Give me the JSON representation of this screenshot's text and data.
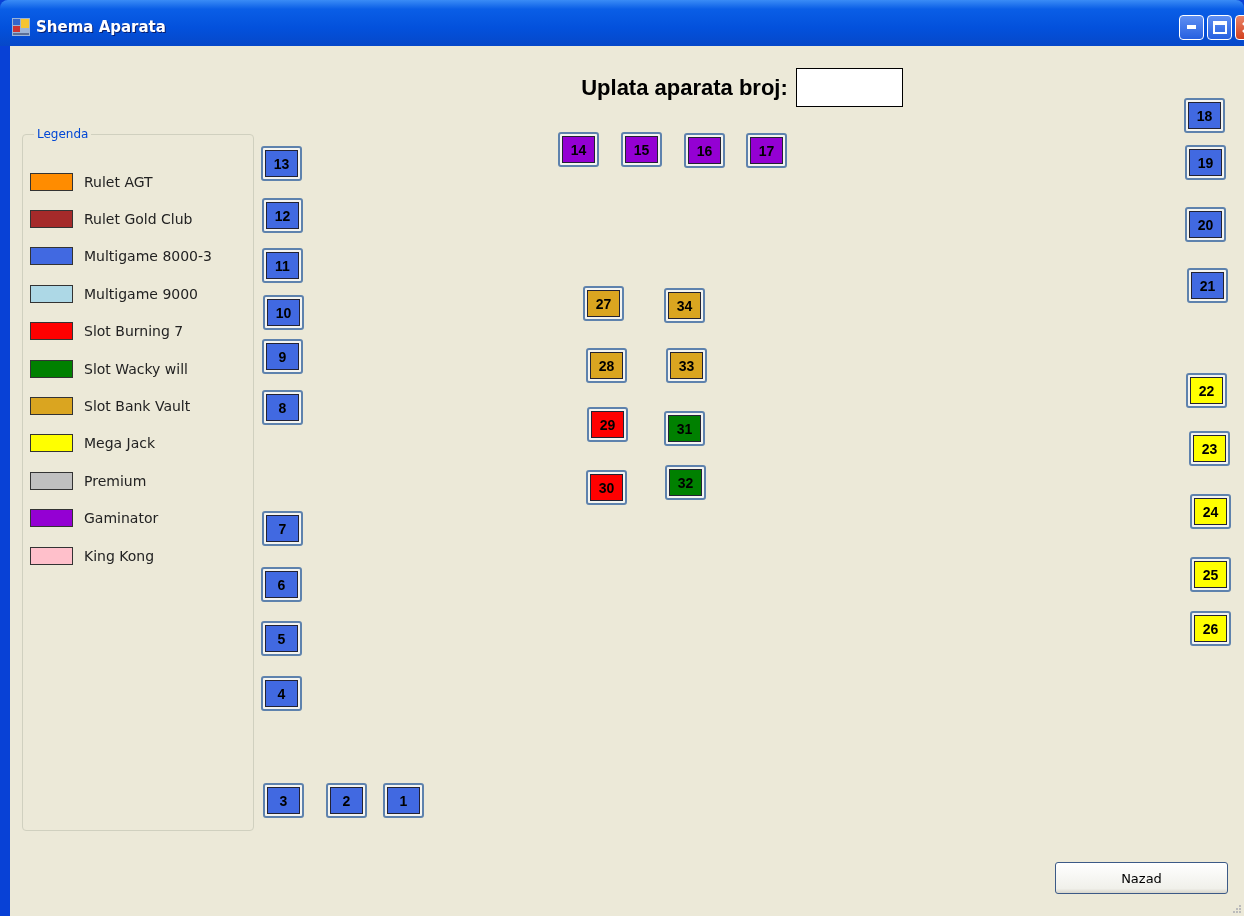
{
  "window": {
    "title": "Shema Aparata"
  },
  "header": {
    "label": "Uplata aparata broj:"
  },
  "legend": {
    "title": "Legenda",
    "items": [
      {
        "label": "Rulet AGT",
        "color": "#ff8c00"
      },
      {
        "label": "Rulet Gold Club",
        "color": "#a52a2a"
      },
      {
        "label": "Multigame 8000-3",
        "color": "#4169e1"
      },
      {
        "label": "Multigame 9000",
        "color": "#add8e6"
      },
      {
        "label": "Slot Burning 7",
        "color": "#ff0000"
      },
      {
        "label": "Slot Wacky will",
        "color": "#008000"
      },
      {
        "label": "Slot Bank Vault",
        "color": "#daa520"
      },
      {
        "label": "Mega Jack",
        "color": "#ffff00"
      },
      {
        "label": "Premium",
        "color": "#c0c0c0"
      },
      {
        "label": "Gaminator",
        "color": "#9400d3"
      },
      {
        "label": "King Kong",
        "color": "#ffc0cb"
      }
    ]
  },
  "machines": [
    {
      "label": "18",
      "color": "#4169e1"
    },
    {
      "label": "13",
      "color": "#4169e1"
    },
    {
      "label": "14",
      "color": "#9400d3"
    },
    {
      "label": "15",
      "color": "#9400d3"
    },
    {
      "label": "16",
      "color": "#9400d3"
    },
    {
      "label": "17",
      "color": "#9400d3"
    },
    {
      "label": "19",
      "color": "#4169e1"
    },
    {
      "label": "12",
      "color": "#4169e1"
    },
    {
      "label": "20",
      "color": "#4169e1"
    },
    {
      "label": "11",
      "color": "#4169e1"
    },
    {
      "label": "10",
      "color": "#4169e1"
    },
    {
      "label": "27",
      "color": "#daa520"
    },
    {
      "label": "34",
      "color": "#daa520"
    },
    {
      "label": "21",
      "color": "#4169e1"
    },
    {
      "label": "9",
      "color": "#4169e1"
    },
    {
      "label": "28",
      "color": "#daa520"
    },
    {
      "label": "33",
      "color": "#daa520"
    },
    {
      "label": "8",
      "color": "#4169e1"
    },
    {
      "label": "22",
      "color": "#ffff00"
    },
    {
      "label": "29",
      "color": "#ff0000"
    },
    {
      "label": "31",
      "color": "#008000"
    },
    {
      "label": "23",
      "color": "#ffff00"
    },
    {
      "label": "30",
      "color": "#ff0000"
    },
    {
      "label": "32",
      "color": "#008000"
    },
    {
      "label": "7",
      "color": "#4169e1"
    },
    {
      "label": "24",
      "color": "#ffff00"
    },
    {
      "label": "6",
      "color": "#4169e1"
    },
    {
      "label": "25",
      "color": "#ffff00"
    },
    {
      "label": "5",
      "color": "#4169e1"
    },
    {
      "label": "26",
      "color": "#ffff00"
    },
    {
      "label": "4",
      "color": "#4169e1"
    },
    {
      "label": "3",
      "color": "#4169e1"
    },
    {
      "label": "2",
      "color": "#4169e1"
    },
    {
      "label": "1",
      "color": "#4169e1"
    }
  ],
  "back_button": "Nazad"
}
